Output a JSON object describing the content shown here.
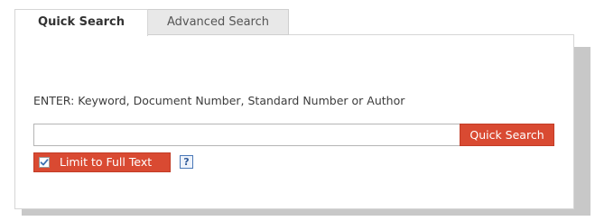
{
  "tabs": {
    "quick_label": "Quick Search",
    "advanced_label": "Advanced Search"
  },
  "search": {
    "instruction": "ENTER: Keyword, Document Number, Standard Number or Author",
    "value": "",
    "placeholder": "",
    "button_label": "Quick Search"
  },
  "limit": {
    "label": "Limit to Full Text",
    "checked": true
  },
  "help": {
    "symbol": "?"
  },
  "colors": {
    "accent": "#d94a32",
    "help_border": "#4a78b8"
  }
}
